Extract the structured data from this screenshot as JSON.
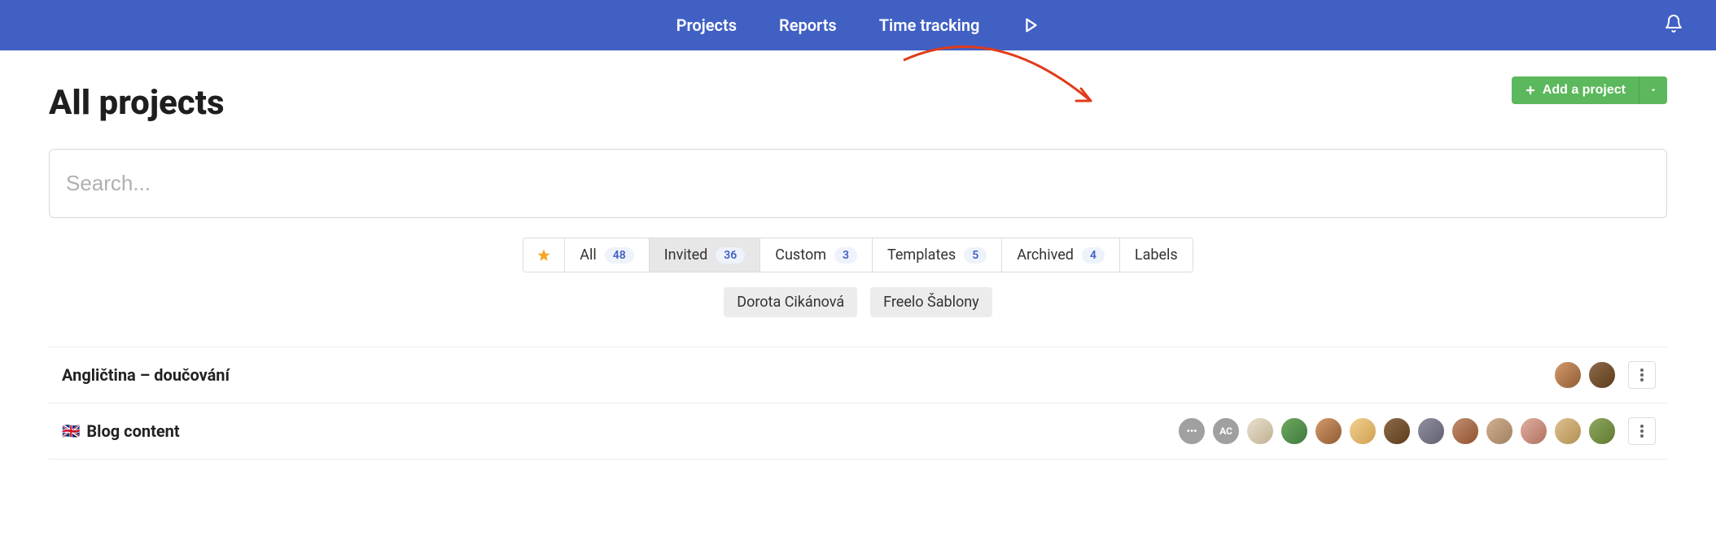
{
  "nav": {
    "projects": "Projects",
    "reports": "Reports",
    "time_tracking": "Time tracking"
  },
  "header": {
    "title": "All projects",
    "add_label": "Add a project"
  },
  "search": {
    "placeholder": "Search..."
  },
  "filters": {
    "all_label": "All",
    "all_count": "48",
    "invited_label": "Invited",
    "invited_count": "36",
    "custom_label": "Custom",
    "custom_count": "3",
    "templates_label": "Templates",
    "templates_count": "5",
    "archived_label": "Archived",
    "archived_count": "4",
    "labels_label": "Labels"
  },
  "tags": {
    "t0": "Dorota Cikánová",
    "t1": "Freelo Šablony"
  },
  "projects": {
    "p0": {
      "name": "Angličtina – doučování"
    },
    "p1": {
      "name": "Blog content",
      "flag": "🇬🇧"
    }
  },
  "avatars": {
    "more_dots": "•••",
    "ac": "AC"
  }
}
